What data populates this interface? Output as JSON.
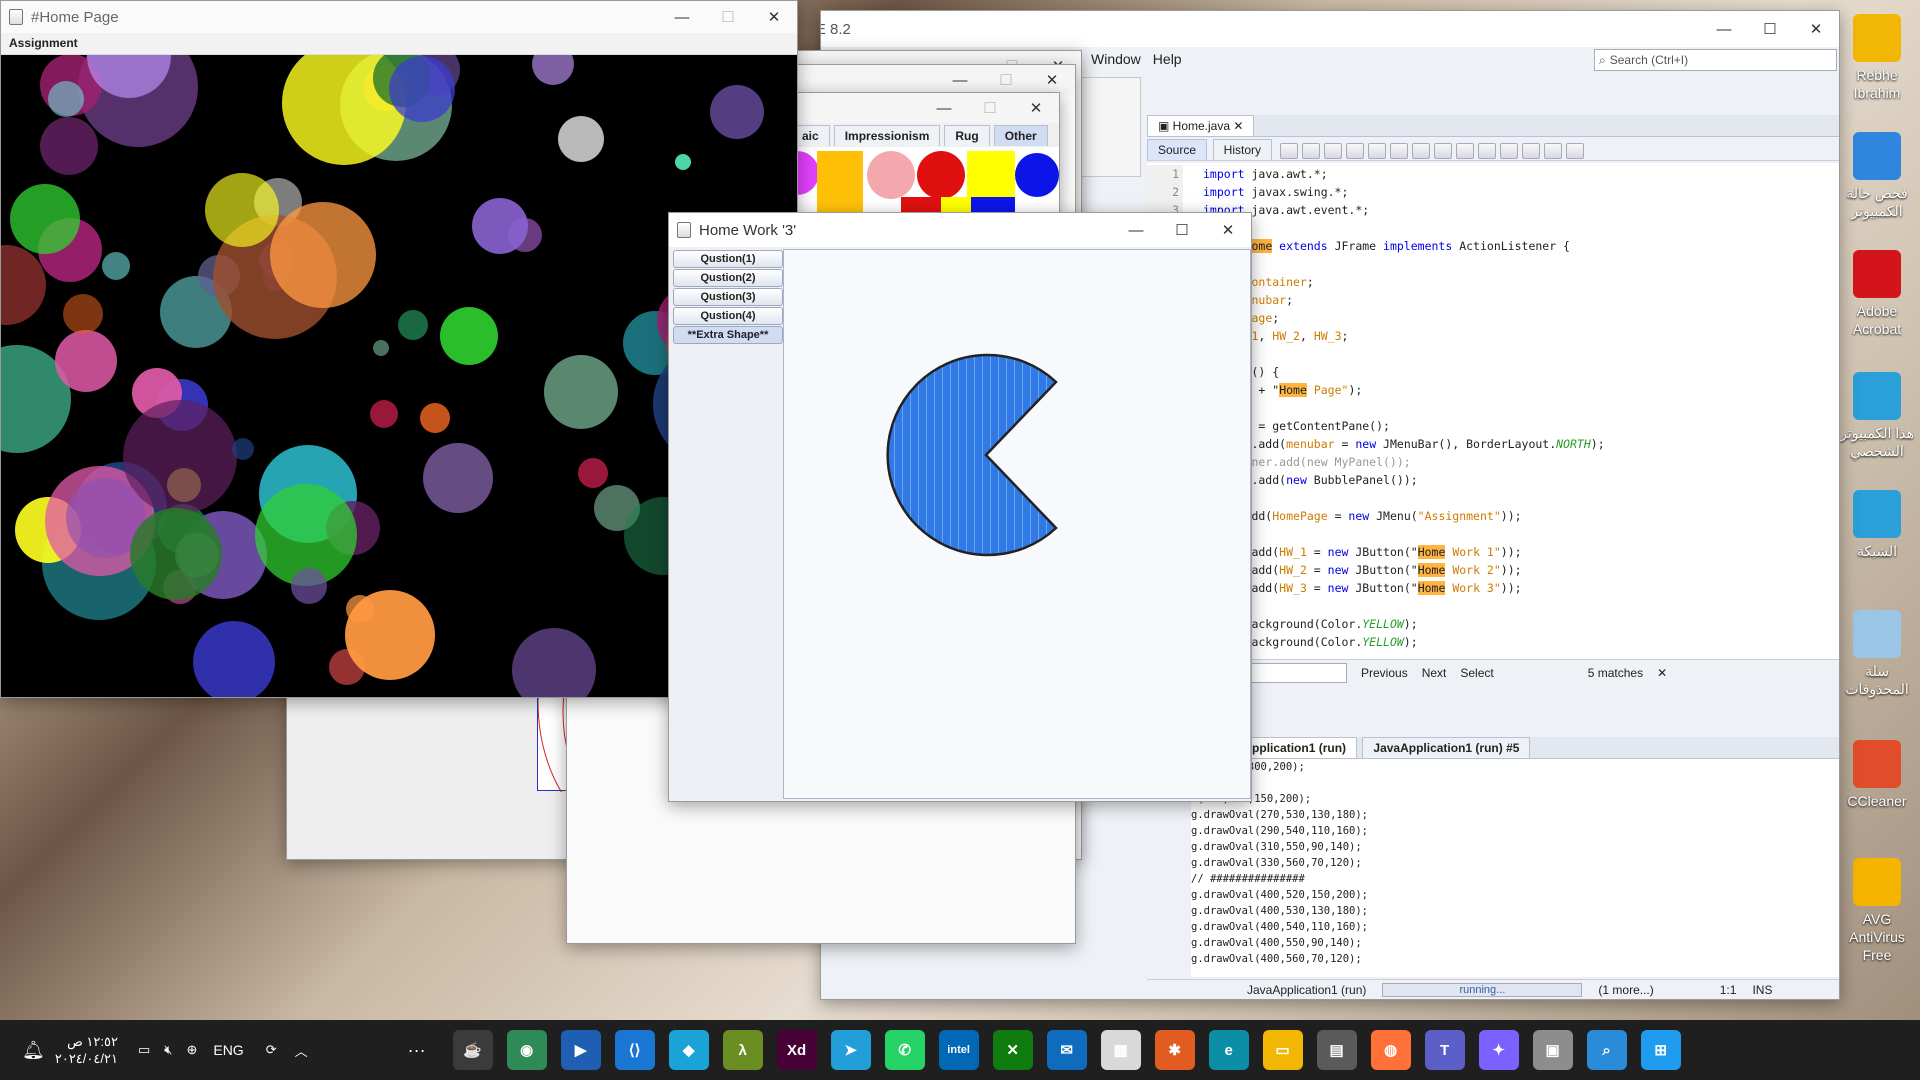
{
  "desktop": {
    "icons": [
      {
        "label": "Rebhe Ibrahim",
        "icon": "folder-user-icon",
        "color": "#f2b705"
      },
      {
        "label": "فحص حالة الكمبيوتر",
        "icon": "pc-health-icon",
        "color": "#2e86de"
      },
      {
        "label": "Adobe Acrobat",
        "icon": "acrobat-icon",
        "color": "#d3151b"
      },
      {
        "label": "هذا الكمبيوتر الشخصي",
        "icon": "this-pc-icon",
        "color": "#2a9fd8"
      },
      {
        "label": "الشبكة",
        "icon": "network-icon",
        "color": "#2a9fd8"
      },
      {
        "label": "سلة المحذوفات",
        "icon": "recycle-bin-icon",
        "color": "#9cc6e8"
      },
      {
        "label": "CCleaner",
        "icon": "ccleaner-icon",
        "color": "#e14d2a"
      },
      {
        "label": "AVG AntiVirus Free",
        "icon": "avg-icon",
        "color": "#f4b400"
      }
    ]
  },
  "netbeans": {
    "title": "DE 8.2",
    "menu": [
      "Window",
      "Help"
    ],
    "search_placeholder": "Search (Ctrl+I)",
    "editor_tab": "Home.java",
    "source_tab": "Source",
    "history_tab": "History",
    "line_numbers": [
      "1",
      "2",
      "3"
    ],
    "code": [
      [
        {
          "t": "import",
          "c": "kw"
        },
        {
          "t": " java.awt.*;"
        }
      ],
      [
        {
          "t": "import",
          "c": "kw"
        },
        {
          "t": " javax.swing.*;"
        }
      ],
      [
        {
          "t": "import",
          "c": "kw"
        },
        {
          "t": " java.awt.event.*;"
        }
      ],
      [
        {
          "t": ""
        }
      ],
      [
        {
          "t": "class ",
          "c": "kw"
        },
        {
          "t": "Home",
          "c": "hl"
        },
        {
          "t": " extends",
          "c": "kw"
        },
        {
          "t": " JFrame "
        },
        {
          "t": "implements",
          "c": "kw"
        },
        {
          "t": " ActionListener {"
        }
      ],
      [
        {
          "t": ""
        }
      ],
      [
        {
          "t": "ainer "
        },
        {
          "t": "container",
          "c": "str"
        },
        {
          "t": ";"
        }
      ],
      [
        {
          "t": "uBar "
        },
        {
          "t": "menubar",
          "c": "str"
        },
        {
          "t": ";"
        }
      ],
      [
        {
          "t": "u "
        },
        {
          "t": "HomePage",
          "c": "str"
        },
        {
          "t": ";"
        }
      ],
      [
        {
          "t": "ton "
        },
        {
          "t": "HW_1",
          "c": "str"
        },
        {
          "t": ", "
        },
        {
          "t": "HW_2",
          "c": "str"
        },
        {
          "t": ", "
        },
        {
          "t": "HW_3",
          "c": "str"
        },
        {
          "t": ";"
        }
      ],
      [
        {
          "t": ""
        }
      ],
      [
        {
          "t": "ic ",
          "c": "kw"
        },
        {
          "t": "Home() {"
        }
      ],
      [
        {
          "t": "per(",
          "c": "kw"
        },
        {
          "t": "\"#\"",
          "c": "str"
        },
        {
          "t": " + "
        },
        {
          "t": "\""
        },
        {
          "t": "Home",
          "c": "hl"
        },
        {
          "t": " Page\"",
          "c": "str"
        },
        {
          "t": ");"
        }
      ],
      [
        {
          "t": ""
        }
      ],
      [
        {
          "t": "ntainer = getContentPane();"
        }
      ],
      [
        {
          "t": "ntainer.add("
        },
        {
          "t": "menubar",
          "c": "str"
        },
        {
          "t": " = "
        },
        {
          "t": "new",
          "c": "kw"
        },
        {
          "t": " JMenuBar(), BorderLayout."
        },
        {
          "t": "NORTH",
          "c": "it"
        },
        {
          "t": ");"
        }
      ],
      [
        {
          "t": " container.add(new MyPanel());",
          "c": "cm"
        }
      ],
      [
        {
          "t": "ntainer.add("
        },
        {
          "t": "new",
          "c": "kw"
        },
        {
          "t": " BubblePanel());"
        }
      ],
      [
        {
          "t": ""
        }
      ],
      [
        {
          "t": "nubar.add("
        },
        {
          "t": "HomePage",
          "c": "str"
        },
        {
          "t": " = "
        },
        {
          "t": "new",
          "c": "kw"
        },
        {
          "t": " JMenu("
        },
        {
          "t": "\"Assignment\"",
          "c": "str"
        },
        {
          "t": "));"
        }
      ],
      [
        {
          "t": ""
        }
      ],
      [
        {
          "t": "mePage.add("
        },
        {
          "t": "HW_1",
          "c": "str"
        },
        {
          "t": " = "
        },
        {
          "t": "new",
          "c": "kw"
        },
        {
          "t": " JButton(\""
        },
        {
          "t": "Home",
          "c": "hl"
        },
        {
          "t": " Work 1\"",
          "c": "str"
        },
        {
          "t": "));"
        }
      ],
      [
        {
          "t": "mePage.add("
        },
        {
          "t": "HW_2",
          "c": "str"
        },
        {
          "t": " = "
        },
        {
          "t": "new",
          "c": "kw"
        },
        {
          "t": " JButton(\""
        },
        {
          "t": "Home",
          "c": "hl"
        },
        {
          "t": " Work 2\"",
          "c": "str"
        },
        {
          "t": "));"
        }
      ],
      [
        {
          "t": "mePage.add("
        },
        {
          "t": "HW_3",
          "c": "str"
        },
        {
          "t": " = "
        },
        {
          "t": "new",
          "c": "kw"
        },
        {
          "t": " JButton(\""
        },
        {
          "t": "Home",
          "c": "hl"
        },
        {
          "t": " Work 3\"",
          "c": "str"
        },
        {
          "t": "));"
        }
      ],
      [
        {
          "t": ""
        }
      ],
      [
        {
          "t": "_1.setBackground(Color."
        },
        {
          "t": "YELLOW",
          "c": "it"
        },
        {
          "t": ");"
        }
      ],
      [
        {
          "t": "_2.setBackground(Color."
        },
        {
          "t": "YELLOW",
          "c": "it"
        },
        {
          "t": ");"
        }
      ]
    ],
    "find": {
      "previous": "Previous",
      "next": "Next",
      "select": "Select",
      "matches": "5 matches"
    },
    "output_tabs": [
      "nsole",
      "JavaApplication1 (run)",
      "JavaApplication1 (run) #5"
    ],
    "output_lines": [
      "(250,520,300,200);",
      "#########",
      "l(250,520,150,200);",
      "g.drawOval(270,530,130,180);",
      "g.drawOval(290,540,110,160);",
      "g.drawOval(310,550,90,140);",
      "g.drawOval(330,560,70,120);",
      "// ###############",
      "g.drawOval(400,520,150,200);",
      "g.drawOval(400,530,130,180);",
      "g.drawOval(400,540,110,160);",
      "g.drawOval(400,550,90,140);",
      "g.drawOval(400,560,70,120);"
    ],
    "status": {
      "app": "JavaApplication1 (run)",
      "progress": "running...",
      "more": "(1 more...)",
      "pos": "1:1",
      "mode": "INS"
    }
  },
  "mosaic_window": {
    "tabs": [
      "aic",
      "Impressionism",
      "Rug",
      "Other"
    ],
    "active_tab": "Other"
  },
  "home_page": {
    "title": "#Home Page",
    "menu_label": "Assignment"
  },
  "hw3": {
    "title": "Home Work '3'",
    "buttons": [
      "Qustion(1)",
      "Qustion(2)",
      "Qustion(3)",
      "Qustion(4)",
      "**Extra Shape**"
    ],
    "shape_color": "#2f7ae5"
  },
  "taskbar": {
    "time": "١٢:٥٢ ص",
    "date": "٢٠٢٤/٠٤/٢١",
    "language": "ENG",
    "apps": [
      {
        "name": "java-app-icon",
        "label": "☕",
        "color": "#3b3b3b"
      },
      {
        "name": "chrome-icon",
        "label": "◉",
        "color": "#2e8b57"
      },
      {
        "name": "media-player-icon",
        "label": "▶",
        "color": "#1e5fb3"
      },
      {
        "name": "vscode-icon",
        "label": "⟨⟩",
        "color": "#1976d2"
      },
      {
        "name": "store-app-icon",
        "label": "◆",
        "color": "#1aa3d6"
      },
      {
        "name": "excel-like-icon",
        "label": "λ",
        "color": "#6b8e23"
      },
      {
        "name": "adobe-xd-icon",
        "label": "Xd",
        "color": "#470137"
      },
      {
        "name": "telegram-icon",
        "label": "➤",
        "color": "#229ed9"
      },
      {
        "name": "whatsapp-icon",
        "label": "✆",
        "color": "#25d366"
      },
      {
        "name": "intel-icon",
        "label": "intel",
        "color": "#0068b5"
      },
      {
        "name": "xbox-icon",
        "label": "✕",
        "color": "#107c10"
      },
      {
        "name": "mail-icon",
        "label": "✉",
        "color": "#0f6cbd"
      },
      {
        "name": "ms-store-icon",
        "label": "▦",
        "color": "#d9d9d9"
      },
      {
        "name": "git-icon",
        "label": "✱",
        "color": "#e25b20"
      },
      {
        "name": "edge-icon",
        "label": "e",
        "color": "#0c8ea7"
      },
      {
        "name": "file-explorer-icon",
        "label": "▭",
        "color": "#f2b705"
      },
      {
        "name": "calculator-icon",
        "label": "▤",
        "color": "#5a5a5a"
      },
      {
        "name": "firefox-icon",
        "label": "◍",
        "color": "#ff7139"
      },
      {
        "name": "teams-icon",
        "label": "T",
        "color": "#5b5fc7"
      },
      {
        "name": "copilot-icon",
        "label": "✦",
        "color": "#7b61ff"
      },
      {
        "name": "window-switch-icon",
        "label": "▣",
        "color": "#8d8d8d"
      },
      {
        "name": "search-app-icon",
        "label": "⌕",
        "color": "#2a8bd8"
      },
      {
        "name": "windows-start-icon",
        "label": "⊞",
        "color": "#1f9bf0"
      }
    ]
  },
  "colors": {
    "netbeans_bg": "#eef1f6",
    "bubble_bg": "#000000",
    "accent": "#ffb340"
  }
}
